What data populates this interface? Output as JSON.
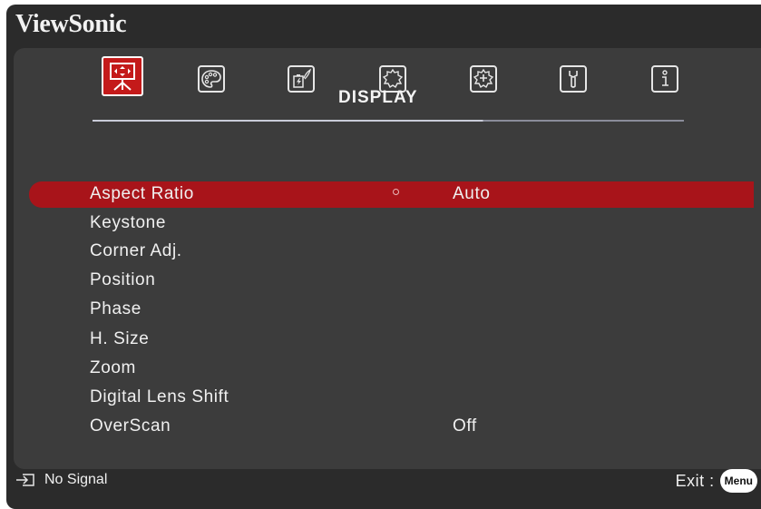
{
  "brand": "ViewSonic",
  "tabs": [
    {
      "icon": "display-icon",
      "active": true
    },
    {
      "icon": "palette-icon",
      "active": false
    },
    {
      "icon": "power-management-icon",
      "active": false
    },
    {
      "icon": "basic-settings-gear-icon",
      "active": false
    },
    {
      "icon": "advanced-settings-gear-icon",
      "active": false
    },
    {
      "icon": "wrench-icon",
      "active": false
    },
    {
      "icon": "information-icon",
      "active": false
    }
  ],
  "tab_title": "DISPLAY",
  "menu": {
    "items": [
      {
        "label": "Aspect Ratio",
        "value": "Auto"
      },
      {
        "label": "Keystone",
        "value": ""
      },
      {
        "label": "Corner Adj.",
        "value": ""
      },
      {
        "label": "Position",
        "value": ""
      },
      {
        "label": "Phase",
        "value": ""
      },
      {
        "label": "H. Size",
        "value": ""
      },
      {
        "label": "Zoom",
        "value": ""
      },
      {
        "label": "Digital Lens Shift",
        "value": ""
      },
      {
        "label": "OverScan",
        "value": "Off"
      }
    ],
    "selected_index": 0
  },
  "footer": {
    "input_icon": "input-source-icon",
    "signal_status": "No Signal",
    "exit_label": "Exit :",
    "menu_key_label": "Menu"
  },
  "colors": {
    "accent": "#c41a1a",
    "selected_row": "#a8141a",
    "panel": "#3c3c3c",
    "frame": "#2b2b2b"
  }
}
